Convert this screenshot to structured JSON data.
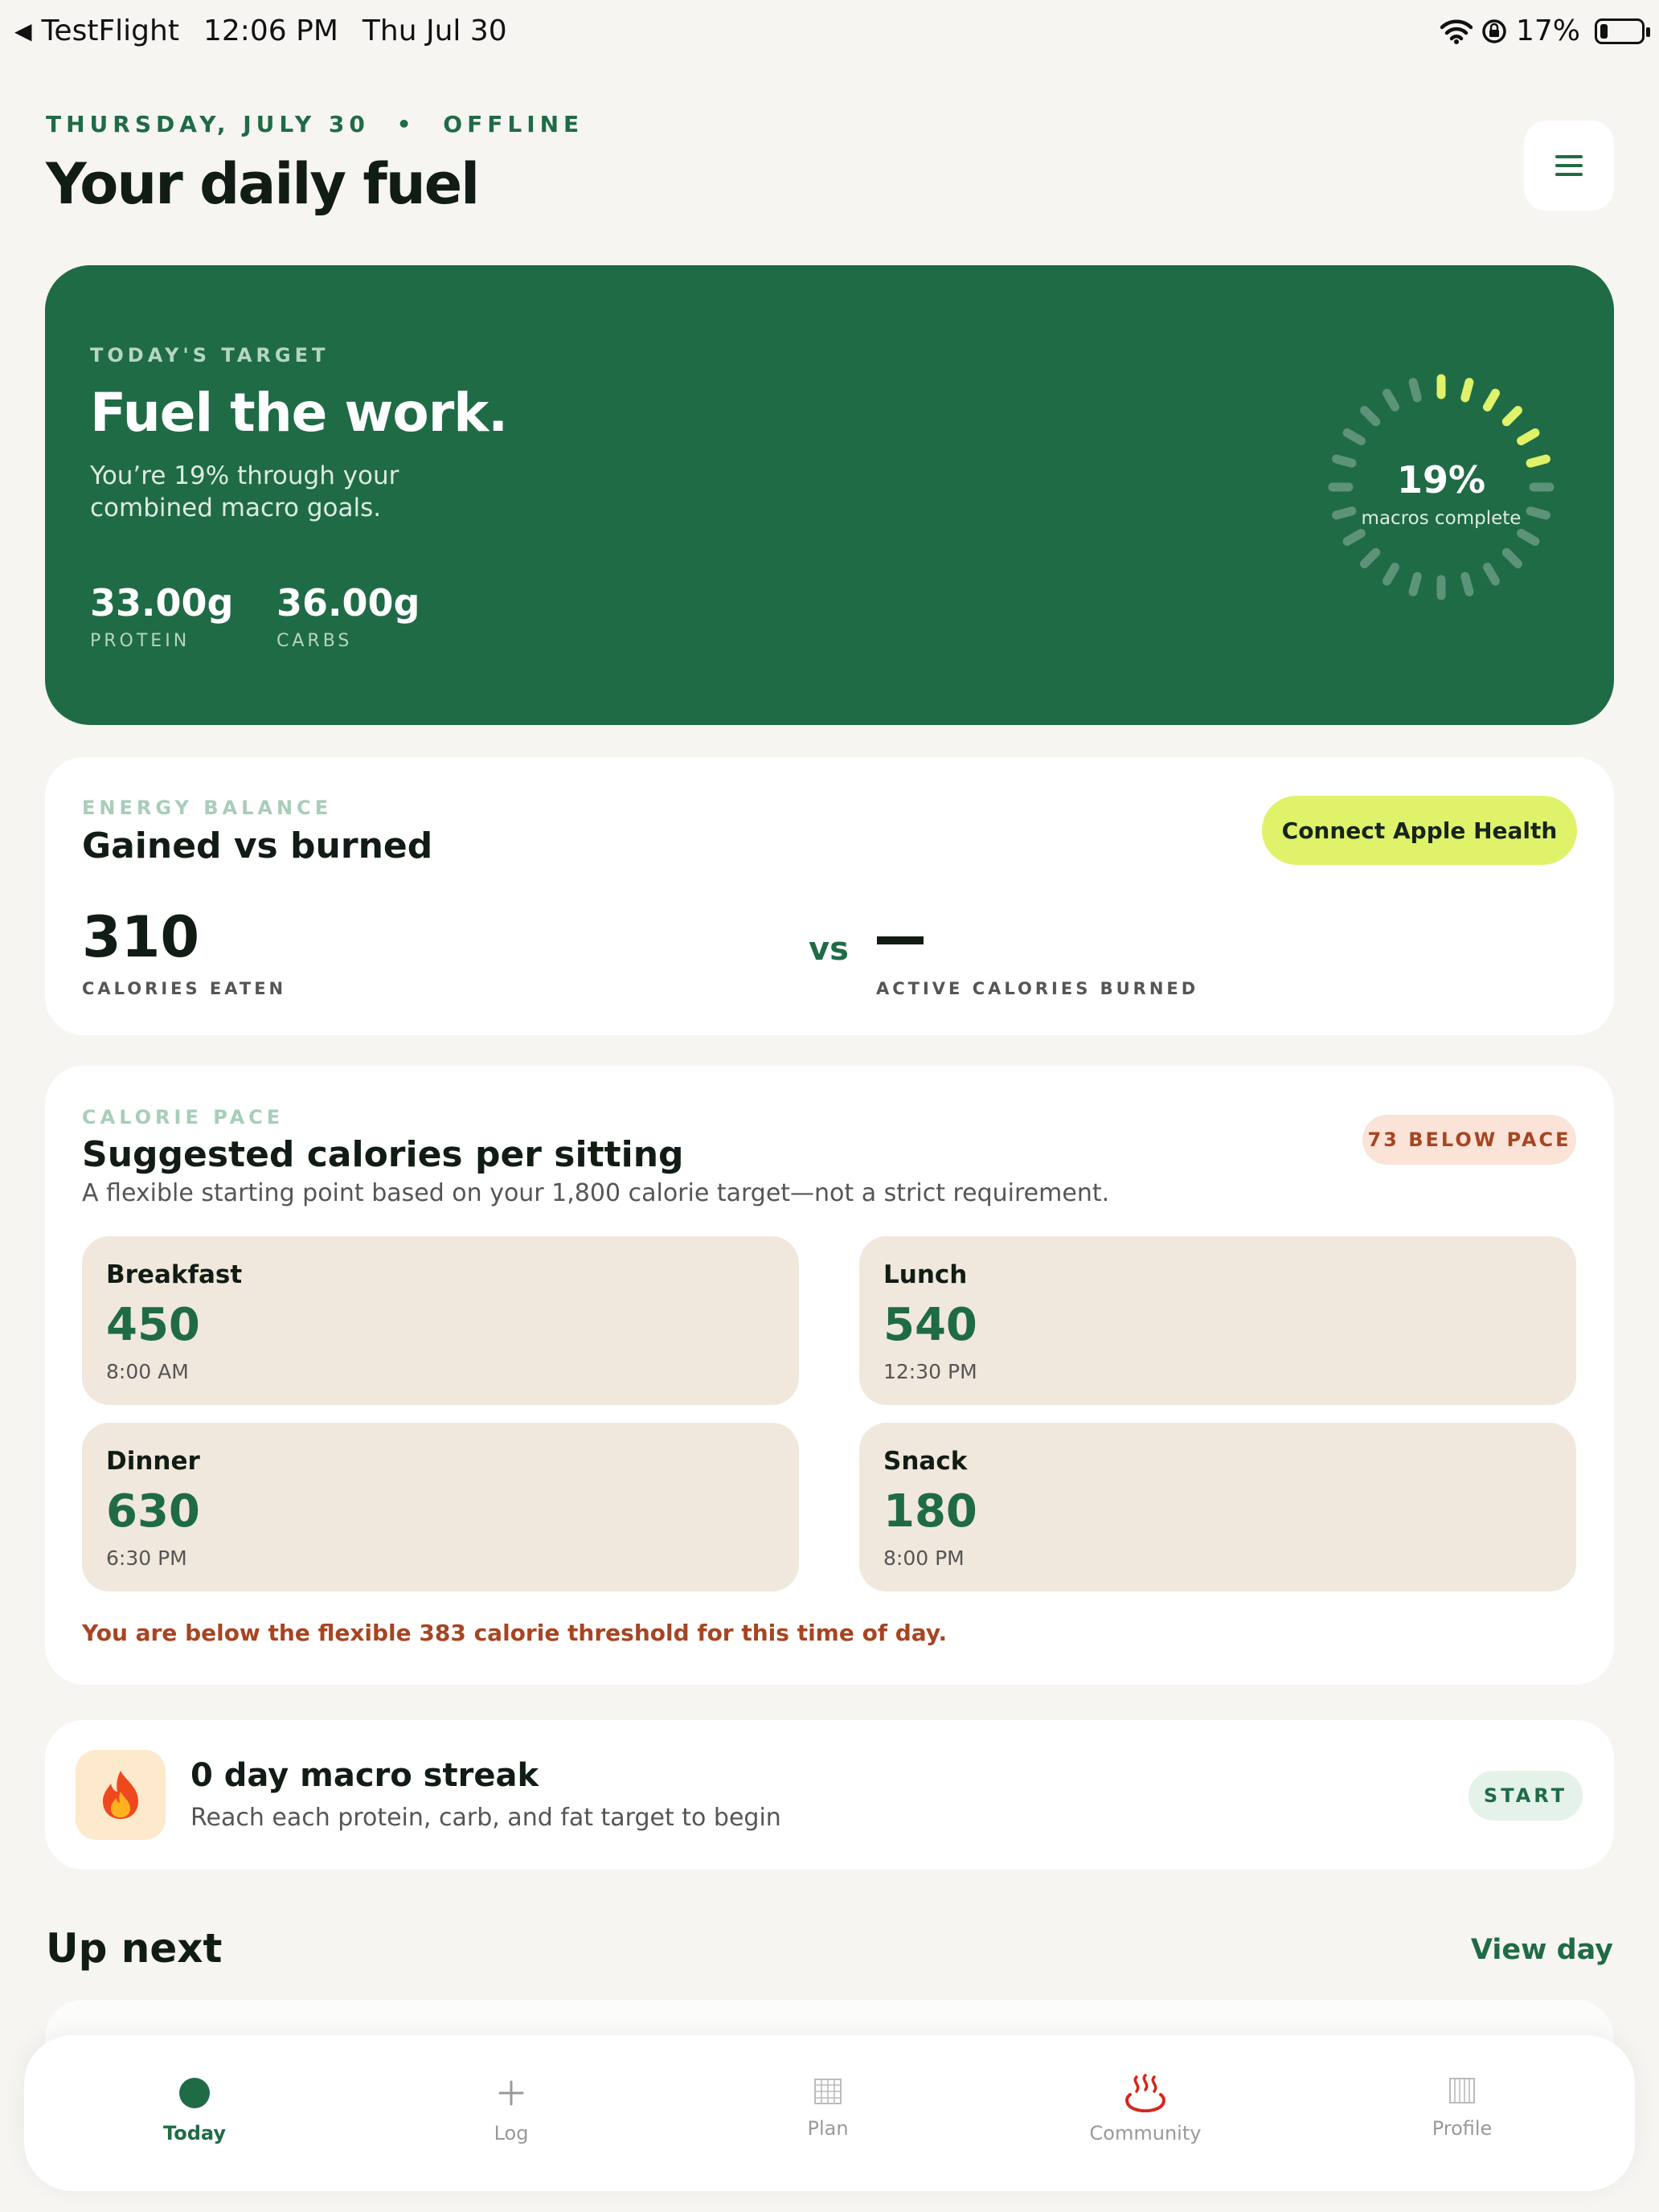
{
  "status_bar": {
    "back_app": "TestFlight",
    "time": "12:06 PM",
    "date": "Thu Jul 30",
    "battery": "17%"
  },
  "header": {
    "date_line": "THURSDAY, JULY 30",
    "separator": "•",
    "connection": "OFFLINE",
    "title": "Your daily fuel"
  },
  "hero": {
    "eyebrow": "TODAY'S TARGET",
    "headline": "Fuel the work.",
    "subtitle": "You’re 19% through your combined macro goals.",
    "stats": [
      {
        "value": "33.00g",
        "label": "PROTEIN"
      },
      {
        "value": "36.00g",
        "label": "CARBS"
      }
    ],
    "ring": {
      "percent_label": "19%",
      "caption": "macros complete",
      "progress": 0.19,
      "accent": "#dff26a"
    }
  },
  "energy": {
    "eyebrow": "ENERGY BALANCE",
    "title": "Gained vs burned",
    "button": "Connect Apple Health",
    "eaten_value": "310",
    "eaten_label": "CALORIES EATEN",
    "vs": "vs",
    "burned_label": "ACTIVE CALORIES BURNED"
  },
  "pace": {
    "eyebrow": "CALORIE PACE",
    "title": "Suggested calories per sitting",
    "subtitle": "A flexible starting point based on your 1,800 calorie target—not a strict requirement.",
    "badge": "73 BELOW PACE",
    "meals": [
      {
        "name": "Breakfast",
        "calories": "450",
        "time": "8:00 AM"
      },
      {
        "name": "Lunch",
        "calories": "540",
        "time": "12:30 PM"
      },
      {
        "name": "Dinner",
        "calories": "630",
        "time": "6:30 PM"
      },
      {
        "name": "Snack",
        "calories": "180",
        "time": "8:00 PM"
      }
    ],
    "warning": "You are below the flexible 383 calorie threshold for this time of day."
  },
  "streak": {
    "icon": "flame-icon",
    "title": "0 day macro streak",
    "subtitle": "Reach each protein, carb, and fat target to begin",
    "button": "START"
  },
  "up_next": {
    "title": "Up next",
    "link": "View day"
  },
  "tabs": [
    {
      "label": "Today",
      "icon": "dot-icon",
      "active": true
    },
    {
      "label": "Log",
      "icon": "plus-icon"
    },
    {
      "label": "Plan",
      "icon": "calendar-icon"
    },
    {
      "label": "Community",
      "icon": "hot-springs-icon"
    },
    {
      "label": "Profile",
      "icon": "id-card-icon"
    }
  ],
  "colors": {
    "brand": "#1f6b46",
    "accent": "#dff26a",
    "warning": "#a74522",
    "background": "#f6f5f1"
  }
}
